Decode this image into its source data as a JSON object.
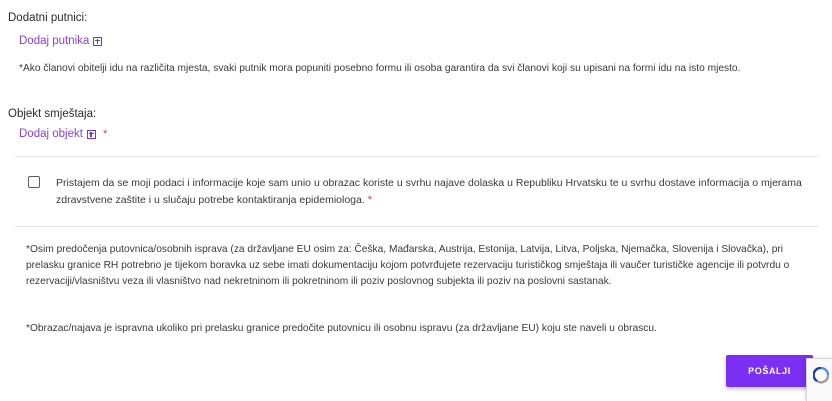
{
  "additional_travelers": {
    "label": "Dodatni putnici:",
    "add_link": "Dodaj putnika",
    "note": "*Ako članovi obitelji idu na različita mjesta, svaki putnik mora popuniti posebno formu ili osoba garantira da svi članovi koji su upisani na formi idu na isto mjesto."
  },
  "accommodation": {
    "label": "Objekt smještaja:",
    "add_link": "Dodaj objekt",
    "required_mark": "*"
  },
  "consent": {
    "text": "Pristajem da se moji podaci i informacije koje sam unio u obrazac koriste u svrhu najave dolaska u Republiku Hrvatsku te u svrhu dostave informacija o mjerama zdravstvene zaštite i u slučaju potrebe kontaktiranja epidemiologa.",
    "required_mark": "*",
    "checked": false
  },
  "notes": {
    "documents": "*Osim predočenja putovnica/osobnih isprava (za državljane EU osim za: Češka, Mađarska, Austrija, Estonija, Latvija, Litva, Poljska, Njemačka, Slovenija i Slovačka), pri prelasku granice RH potrebno je tijekom boravka uz sebe imati dokumentaciju kojom potvrđujete rezervaciju turističkog smještaja ili vaučer turističke agencije ili potvrdu o rezervaciji/vlasništvu veza ili vlasništvo nad nekretninom ili pokretninom ili poziv poslovnog subjekta ili poziv na poslovni sastanak.",
    "validity": "*Obrazac/najava je ispravna ukoliko pri prelasku granice predočite putovnicu ili osobnu ispravu (za državljane EU) koju ste naveli u obrascu."
  },
  "submit": {
    "label": "POŠALJI"
  },
  "colors": {
    "accent": "#7b2ff2",
    "link": "#8a3fd8",
    "required": "#e53935"
  },
  "icons": {
    "add": "plus-square-icon",
    "recaptcha": "recaptcha-icon"
  }
}
